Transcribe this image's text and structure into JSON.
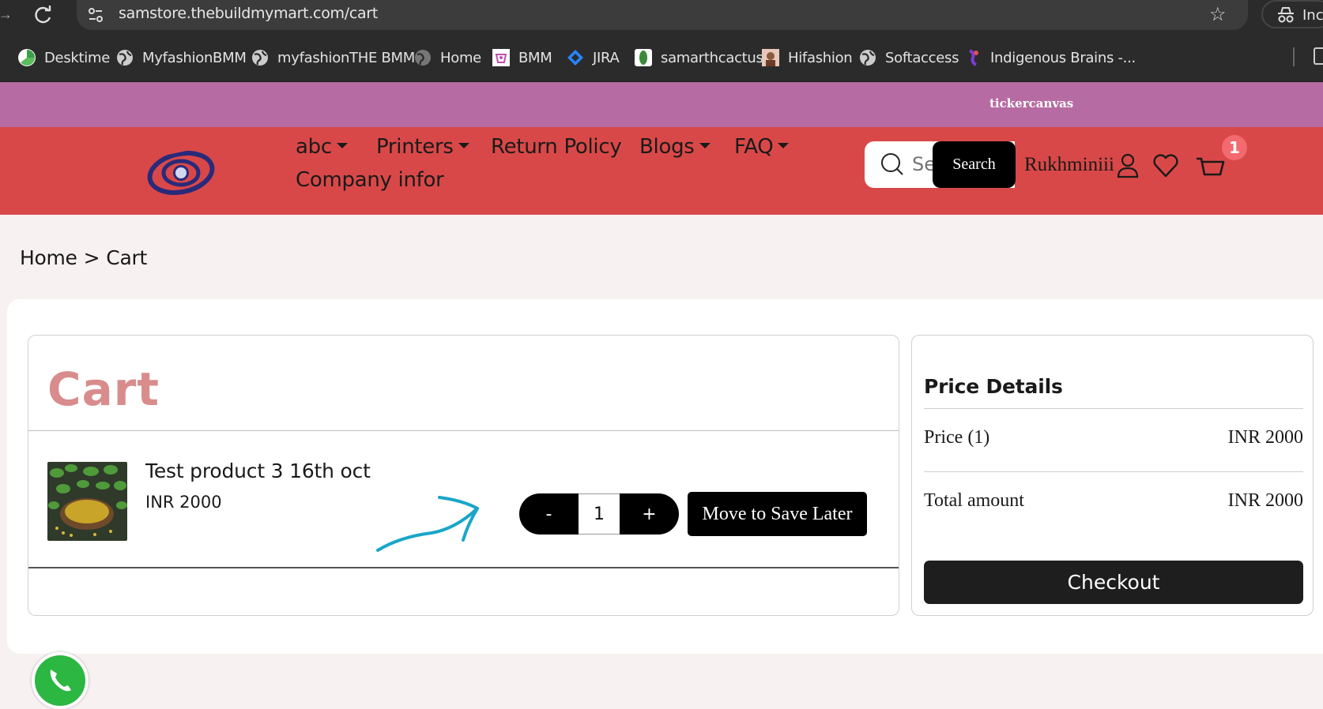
{
  "browser": {
    "url": "samstore.thebuildmymart.com/cart",
    "incognito_label": "Inc",
    "bookmarks": [
      {
        "label": "Desktime",
        "icon": "desktime-icon"
      },
      {
        "label": "MyfashionBMM",
        "icon": "globe-icon"
      },
      {
        "label": "myfashionTHE BMM",
        "icon": "globe-icon"
      },
      {
        "label": "Home",
        "icon": "globe-icon"
      },
      {
        "label": "BMM",
        "icon": "bmm-icon"
      },
      {
        "label": "JIRA",
        "icon": "jira-icon"
      },
      {
        "label": "samarthcactus",
        "icon": "cactus-icon"
      },
      {
        "label": "Hifashion",
        "icon": "hifashion-icon"
      },
      {
        "label": "Softaccess",
        "icon": "globe-icon"
      },
      {
        "label": "Indigenous Brains -...",
        "icon": "indigenous-icon"
      }
    ]
  },
  "ticker": {
    "text": "tickercanvas"
  },
  "header": {
    "menu": [
      {
        "label": "abc",
        "dropdown": true
      },
      {
        "label": "Printers",
        "dropdown": true
      },
      {
        "label": "Return Policy",
        "dropdown": false
      },
      {
        "label": "Blogs",
        "dropdown": true
      },
      {
        "label": "FAQ",
        "dropdown": true
      },
      {
        "label": "Company infor",
        "dropdown": false
      }
    ],
    "search_placeholder": "Search",
    "search_button": "Search",
    "username": "Rukhminiii",
    "cart_count": "1",
    "colors": {
      "header_bg": "#d94848",
      "ticker_bg": "#b66ca2"
    }
  },
  "breadcrumb": {
    "home": "Home",
    "separator": ">",
    "current": "Cart"
  },
  "cart": {
    "title": "Cart",
    "item": {
      "name": "Test product 3 16th oct",
      "price": "INR 2000",
      "quantity": "1",
      "minus_label": "-",
      "plus_label": "+",
      "save_later_label": "Move to Save Later"
    }
  },
  "price_details": {
    "title": "Price Details",
    "price_label": "Price (1)",
    "price_value": "INR 2000",
    "total_label": "Total amount",
    "total_value": "INR 2000",
    "checkout_label": "Checkout"
  }
}
